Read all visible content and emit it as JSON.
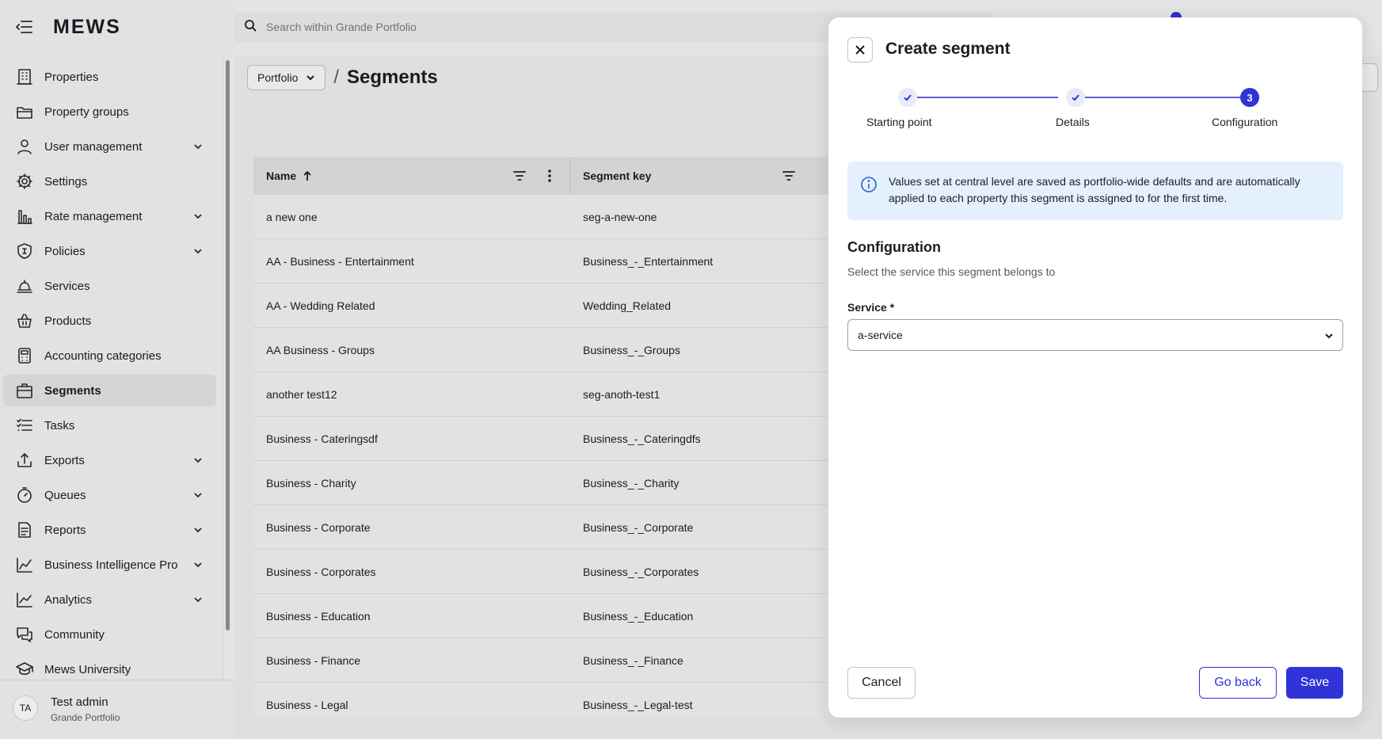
{
  "app": {
    "logo": "MEWS",
    "search_placeholder": "Search within Grande Portfolio"
  },
  "sidebar": {
    "items": [
      {
        "label": "Properties",
        "icon": "building-icon",
        "expandable": false,
        "active": false
      },
      {
        "label": "Property groups",
        "icon": "folder-icon",
        "expandable": false,
        "active": false
      },
      {
        "label": "User management",
        "icon": "user-icon",
        "expandable": true,
        "active": false
      },
      {
        "label": "Settings",
        "icon": "gear-icon",
        "expandable": false,
        "active": false
      },
      {
        "label": "Rate management",
        "icon": "bar-chart-icon",
        "expandable": true,
        "active": false
      },
      {
        "label": "Policies",
        "icon": "shield-icon",
        "expandable": true,
        "active": false
      },
      {
        "label": "Services",
        "icon": "bell-icon",
        "expandable": false,
        "active": false
      },
      {
        "label": "Products",
        "icon": "basket-icon",
        "expandable": false,
        "active": false
      },
      {
        "label": "Accounting categories",
        "icon": "calculator-icon",
        "expandable": false,
        "active": false
      },
      {
        "label": "Segments",
        "icon": "briefcase-icon",
        "expandable": false,
        "active": true
      },
      {
        "label": "Tasks",
        "icon": "list-icon",
        "expandable": false,
        "active": false
      },
      {
        "label": "Exports",
        "icon": "export-icon",
        "expandable": true,
        "active": false
      },
      {
        "label": "Queues",
        "icon": "stopwatch-icon",
        "expandable": true,
        "active": false
      },
      {
        "label": "Reports",
        "icon": "document-icon",
        "expandable": true,
        "active": false
      },
      {
        "label": "Business Intelligence Pro",
        "icon": "line-chart-icon",
        "expandable": true,
        "active": false
      },
      {
        "label": "Analytics",
        "icon": "trend-icon",
        "expandable": true,
        "active": false
      },
      {
        "label": "Community",
        "icon": "chat-icon",
        "expandable": false,
        "active": false
      },
      {
        "label": "Mews University",
        "icon": "graduation-cap-icon",
        "expandable": false,
        "active": false
      }
    ],
    "user": {
      "initials": "TA",
      "name": "Test admin",
      "org": "Grande Portfolio"
    }
  },
  "page": {
    "breadcrumb_root": "Portfolio",
    "separator": "/",
    "title": "Segments"
  },
  "table": {
    "columns": [
      "Name",
      "Segment key"
    ],
    "rows": [
      {
        "name": "a new one",
        "key": "seg-a-new-one"
      },
      {
        "name": "AA - Business - Entertainment",
        "key": "Business_-_Entertainment"
      },
      {
        "name": "AA - Wedding Related",
        "key": "Wedding_Related"
      },
      {
        "name": "AA Business - Groups",
        "key": "Business_-_Groups"
      },
      {
        "name": "another test12",
        "key": "seg-anoth-test1"
      },
      {
        "name": "Business - Cateringsdf",
        "key": "Business_-_Cateringdfs"
      },
      {
        "name": "Business - Charity",
        "key": "Business_-_Charity"
      },
      {
        "name": "Business - Corporate",
        "key": "Business_-_Corporate"
      },
      {
        "name": "Business - Corporates",
        "key": "Business_-_Corporates"
      },
      {
        "name": "Business - Education",
        "key": "Business_-_Education"
      },
      {
        "name": "Business - Finance",
        "key": "Business_-_Finance"
      },
      {
        "name": "Business - Legal",
        "key": "Business_-_Legal-test"
      }
    ]
  },
  "modal": {
    "title": "Create segment",
    "steps": [
      {
        "label": "Starting point",
        "state": "done"
      },
      {
        "label": "Details",
        "state": "done"
      },
      {
        "label": "Configuration",
        "state": "current",
        "number": "3"
      }
    ],
    "info": "Values set at central level are saved as portfolio-wide defaults and are automatically applied to each property this segment is assigned to for the first time.",
    "section_title": "Configuration",
    "section_subtitle": "Select the service this segment belongs to",
    "field_label": "Service *",
    "field_value": "a-service",
    "buttons": {
      "cancel": "Cancel",
      "back": "Go back",
      "save": "Save"
    }
  },
  "colors": {
    "accent": "#2f33d8",
    "info_bg": "#e4f0fd"
  }
}
